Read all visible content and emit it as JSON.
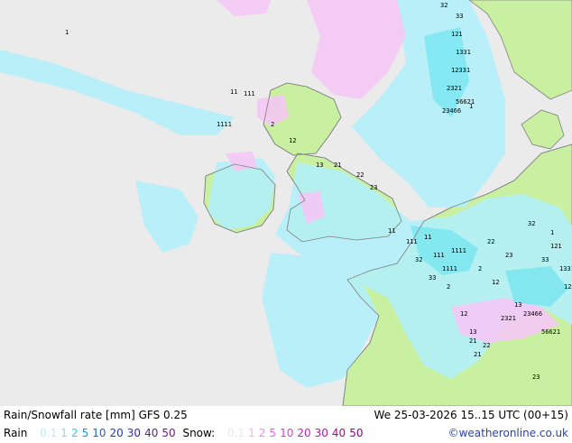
{
  "title": "Rain/Snowfall rate [mm] GFS 0.25",
  "datetime": "We 25-03-2026 15..15 UTC (00+15)",
  "legend": {
    "rain_label": "Rain",
    "rain_values": [
      "0.1",
      "1",
      "2",
      "5",
      "10",
      "20",
      "30",
      "40",
      "50"
    ],
    "rain_colors": [
      "#b4f0fa",
      "#78e6f0",
      "#3cc8e6",
      "#1e96d2",
      "#1e64c8",
      "#1e3cb4",
      "#3c28a0",
      "#5a1e96",
      "#78148c"
    ],
    "snow_label": "Snow:",
    "snow_values": [
      "0.1",
      "1",
      "2",
      "5",
      "10",
      "20",
      "30",
      "40",
      "50"
    ],
    "snow_colors": [
      "#fadcfa",
      "#f5b4f0",
      "#f08ce6",
      "#e664dc",
      "#dc3cd2",
      "#c81ebe",
      "#b414aa",
      "#a00a96",
      "#8c0082"
    ]
  },
  "credit": "©weatheronline.co.uk",
  "colors": {
    "sea": "#ebebeb",
    "land": "#c8f0a0",
    "rain_light": "#b4f0fa",
    "rain_med": "#78e6f0",
    "snow_light": "#f5c8f5",
    "coast": "#808080",
    "marks": "#000000"
  },
  "map_marks": [
    "1",
    "11",
    "111",
    "1111",
    "2",
    "12",
    "13",
    "21",
    "22",
    "23",
    "32",
    "33",
    "121",
    "1331",
    "12331",
    "2321",
    "23466",
    "56621"
  ]
}
